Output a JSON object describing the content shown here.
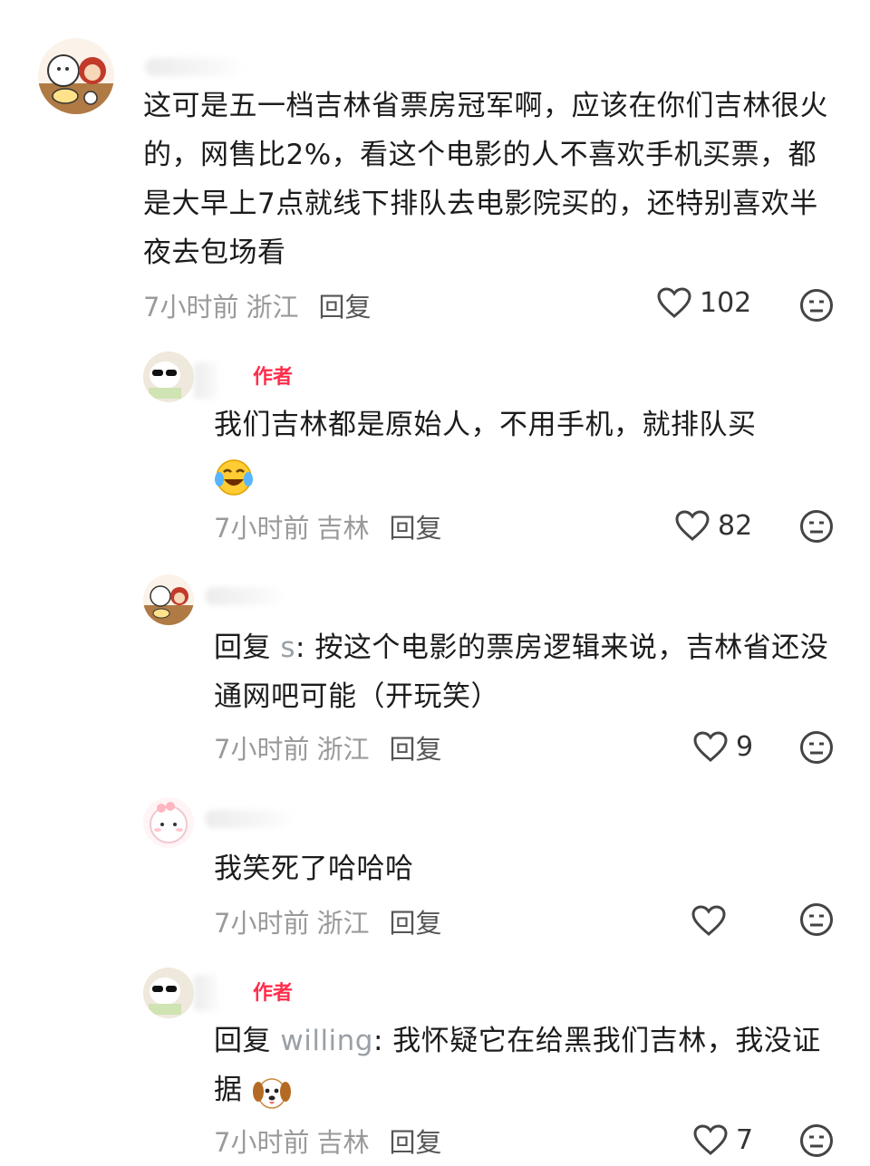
{
  "comments": [
    {
      "text": "这可是五一档吉林省票房冠军啊，应该在你们吉林很火的，网售比2%，看这个电影的人不喜欢手机买票，都是大早上7点就线下排队去电影院买的，还特别喜欢半夜去包场看",
      "time": "7小时前",
      "location": "浙江",
      "reply": "回复",
      "likes": "102"
    },
    {
      "author_tag": "作者",
      "text": "我们吉林都是原始人，不用手机，就排队买",
      "emoji": "tears-of-joy-emoji",
      "time": "7小时前",
      "location": "吉林",
      "reply": "回复",
      "likes": "82"
    },
    {
      "reply_prefix": "回复",
      "reply_to": "s",
      "text": ": 按这个电影的票房逻辑来说，吉林省还没通网吧可能（开玩笑）",
      "time": "7小时前",
      "location": "浙江",
      "reply": "回复",
      "likes": "9"
    },
    {
      "text": "我笑死了哈哈哈",
      "time": "7小时前",
      "location": "浙江",
      "reply": "回复",
      "likes": ""
    },
    {
      "author_tag": "作者",
      "reply_prefix": "回复",
      "reply_to": "willing",
      "text": ": 我怀疑它在给黑我们吉林，我没证据",
      "emoji": "dog-emoji",
      "time": "7小时前",
      "location": "吉林",
      "reply": "回复",
      "likes": "7"
    }
  ],
  "icons": {
    "like": "heart-outline-icon",
    "dislike": "meh-face-icon"
  },
  "colors": {
    "author_tag": "#ff2d4a",
    "meta": "#9a9a9a",
    "reply_user": "#9aa0a6"
  }
}
